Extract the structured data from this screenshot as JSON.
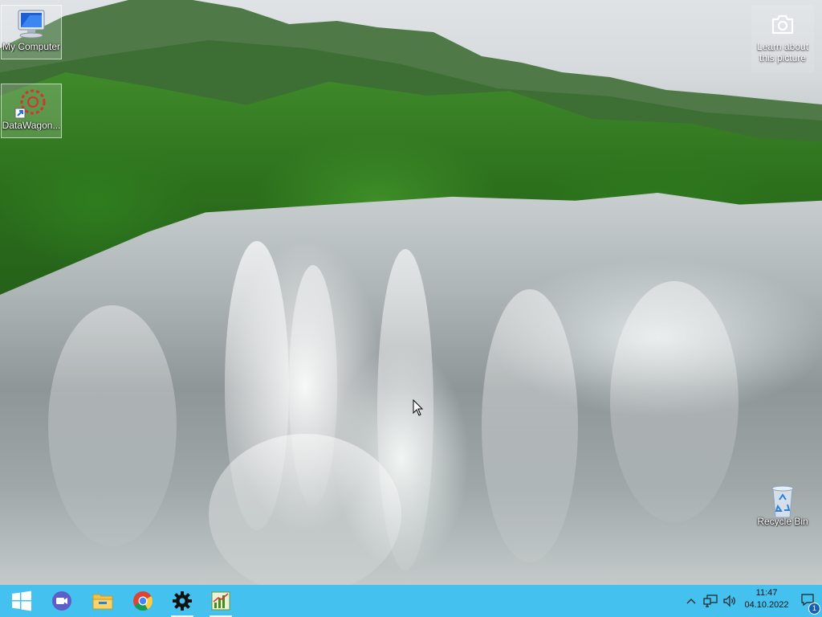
{
  "desktop": {
    "icons": [
      {
        "label": "My Computer",
        "icon": "computer-icon"
      },
      {
        "label": "DataWagon...",
        "icon": "datawagon-shortcut-icon"
      },
      {
        "label": "Recycle Bin",
        "icon": "recycle-bin-icon"
      }
    ],
    "spotlight": {
      "label_line1": "Learn about",
      "label_line2": "this picture",
      "icon": "camera-icon"
    }
  },
  "taskbar": {
    "color": "#44c1ee",
    "apps": [
      {
        "name": "Start",
        "icon": "windows-start-icon"
      },
      {
        "name": "Meet",
        "icon": "video-call-icon"
      },
      {
        "name": "File Explorer",
        "icon": "folder-icon"
      },
      {
        "name": "Chrome",
        "icon": "chrome-icon"
      },
      {
        "name": "Settings",
        "icon": "gear-icon"
      },
      {
        "name": "Task Manager",
        "icon": "chart-app-icon"
      }
    ],
    "tray": {
      "time": "11:47",
      "date": "04.10.2022",
      "notification_count": "1"
    }
  }
}
